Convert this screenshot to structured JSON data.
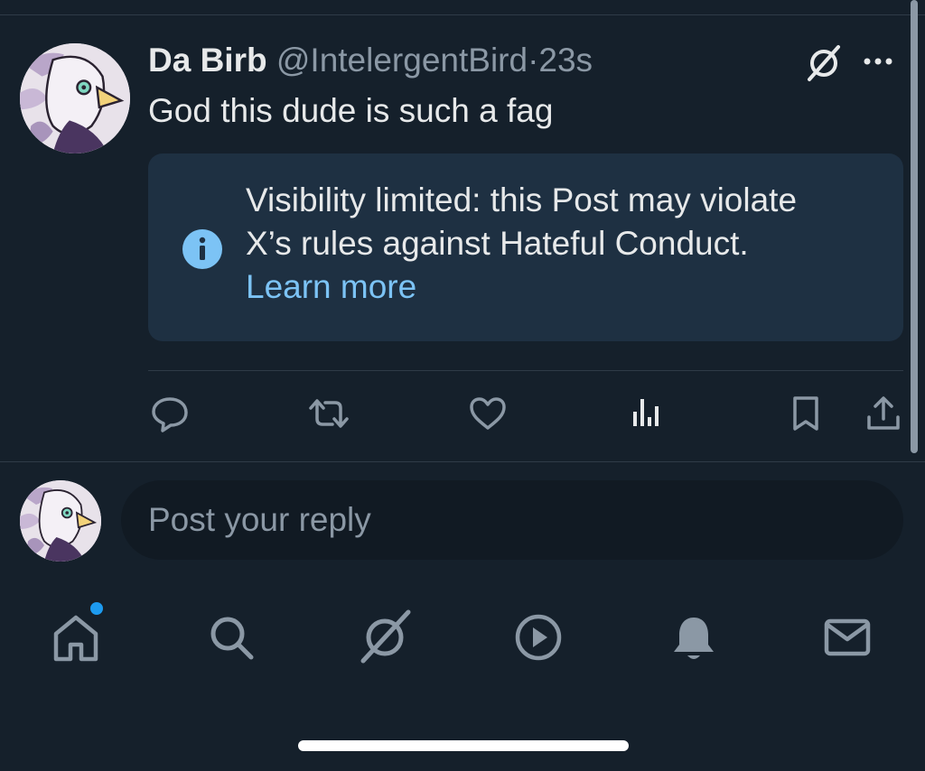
{
  "post": {
    "author_name": "Da Birb",
    "author_handle": "@IntelergentBird",
    "separator": "·",
    "time": "23s",
    "text": "God this dude is such a fag"
  },
  "notice": {
    "line1": "Visibility limited: this Post may violate",
    "line2": "X’s rules against Hateful Conduct.",
    "link": "Learn more"
  },
  "actions": {
    "icons": [
      "reply-icon",
      "repost-icon",
      "like-icon",
      "views-icon",
      "bookmark-icon",
      "share-icon"
    ]
  },
  "reply": {
    "placeholder": "Post your reply"
  },
  "bottom_nav": {
    "items": [
      "home-icon",
      "search-icon",
      "grok-icon",
      "video-icon",
      "notifications-icon",
      "messages-icon"
    ],
    "home_has_badge": true
  },
  "colors": {
    "background": "#15202b",
    "notice_bg": "#1e3042",
    "accent": "#1d9bf0",
    "link": "#7cc3f5",
    "muted": "#8b98a5",
    "info_icon": "#7cc3f5"
  }
}
